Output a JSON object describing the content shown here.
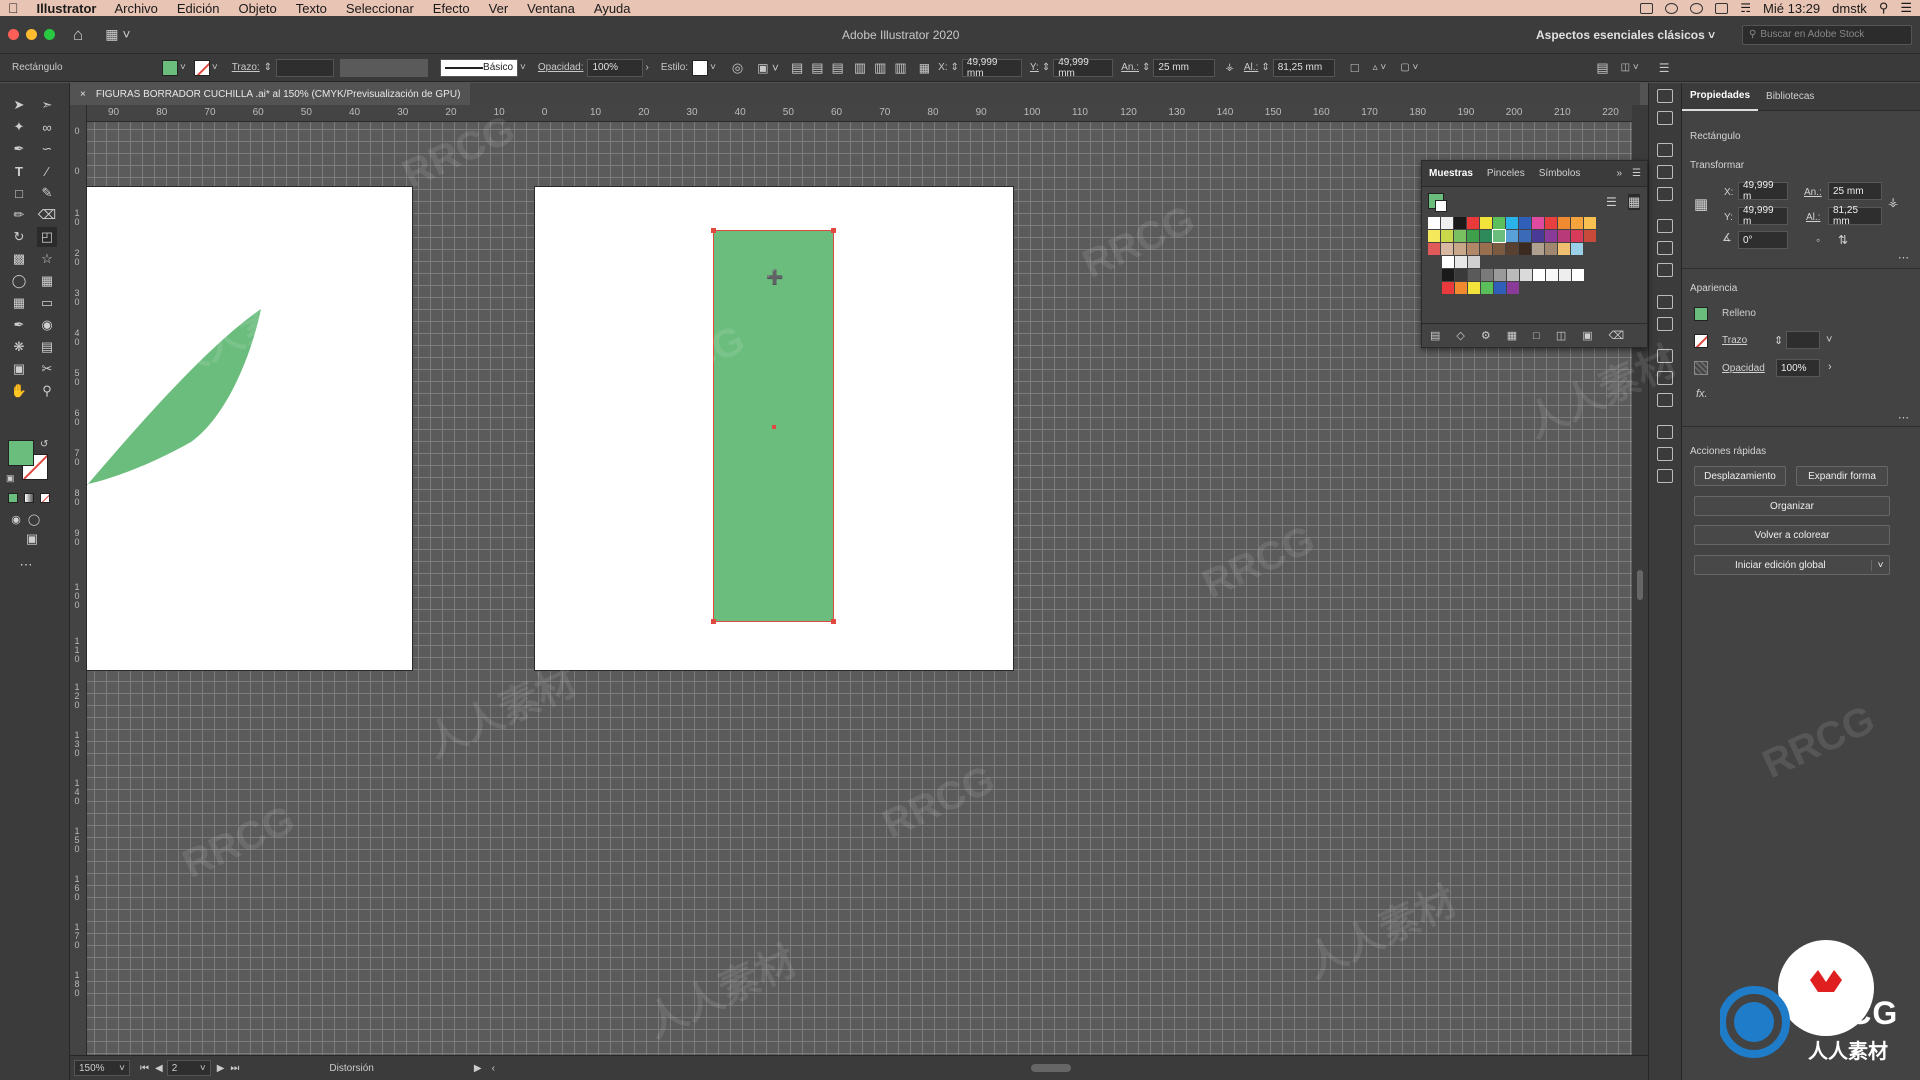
{
  "menubar": {
    "app": "Illustrator",
    "items": [
      "Archivo",
      "Edición",
      "Objeto",
      "Texto",
      "Seleccionar",
      "Efecto",
      "Ver",
      "Ventana",
      "Ayuda"
    ],
    "clock": "Mié 13:29",
    "user": "dmstk"
  },
  "titlebar": {
    "title": "Adobe Illustrator 2020",
    "workspace": "Aspectos esenciales clásicos",
    "search_placeholder": "Buscar en Adobe Stock"
  },
  "control": {
    "object": "Rectángulo",
    "stroke_label": "Trazo:",
    "brush": "Básico",
    "opacity_label": "Opacidad:",
    "opacity": "100%",
    "style_label": "Estilo:",
    "x_label": "X:",
    "x": "49,999 mm",
    "y_label": "Y:",
    "y": "49,999 mm",
    "w_label": "An.:",
    "w": "25 mm",
    "h_label": "Al.:",
    "h": "81,25 mm"
  },
  "document": {
    "tab": "FIGURAS BORRADOR CUCHILLA .ai* al 150% (CMYK/Previsualización de GPU)"
  },
  "ruler": {
    "h": [
      "90",
      "80",
      "70",
      "60",
      "50",
      "40",
      "30",
      "20",
      "10",
      "0",
      "10",
      "20",
      "30",
      "40",
      "50",
      "60",
      "70",
      "80",
      "90",
      "100",
      "110",
      "120",
      "130",
      "140",
      "150",
      "160",
      "170",
      "180",
      "190",
      "200",
      "210",
      "220"
    ],
    "v": [
      "0",
      "0",
      "1 0",
      "2 0",
      "3 0",
      "4 0",
      "5 0",
      "6 0",
      "7 0",
      "8 0",
      "9 0",
      "1 0 0",
      "1 1 0",
      "1 2 0",
      "1 3 0",
      "1 4 0",
      "1 5 0",
      "1 6 0",
      "1 7 0",
      "1 8 0"
    ]
  },
  "swatches": {
    "tabs": [
      "Muestras",
      "Pinceles",
      "Símbolos"
    ]
  },
  "properties": {
    "tabs": [
      "Propiedades",
      "Bibliotecas"
    ],
    "object": "Rectángulo",
    "transform_title": "Transformar",
    "x_label": "X:",
    "x": "49,999 m",
    "y_label": "Y:",
    "y": "49,999 m",
    "w_label": "An.:",
    "w": "25 mm",
    "h_label": "Al.:",
    "h": "81,25 mm",
    "angle": "0°",
    "appearance_title": "Apariencia",
    "fill": "Relleno",
    "stroke": "Trazo",
    "opacity_label": "Opacidad",
    "opacity": "100%",
    "fx": "fx.",
    "quick_title": "Acciones rápidas",
    "btn_offset": "Desplazamiento",
    "btn_expand": "Expandir forma",
    "btn_arrange": "Organizar",
    "btn_recolor": "Volver a colorear",
    "btn_global": "Iniciar edición global"
  },
  "status": {
    "zoom": "150%",
    "artboard": "2",
    "tool": "Distorsión"
  },
  "watermark": {
    "text1": "RRCG",
    "text2": "人人素材"
  },
  "logo": {
    "brand": "RRCG",
    "sub": "人人素材"
  },
  "colors": {
    "fill": "#6bbd7d",
    "menubar": "#e8c4b4",
    "accent": "#e0493f"
  }
}
